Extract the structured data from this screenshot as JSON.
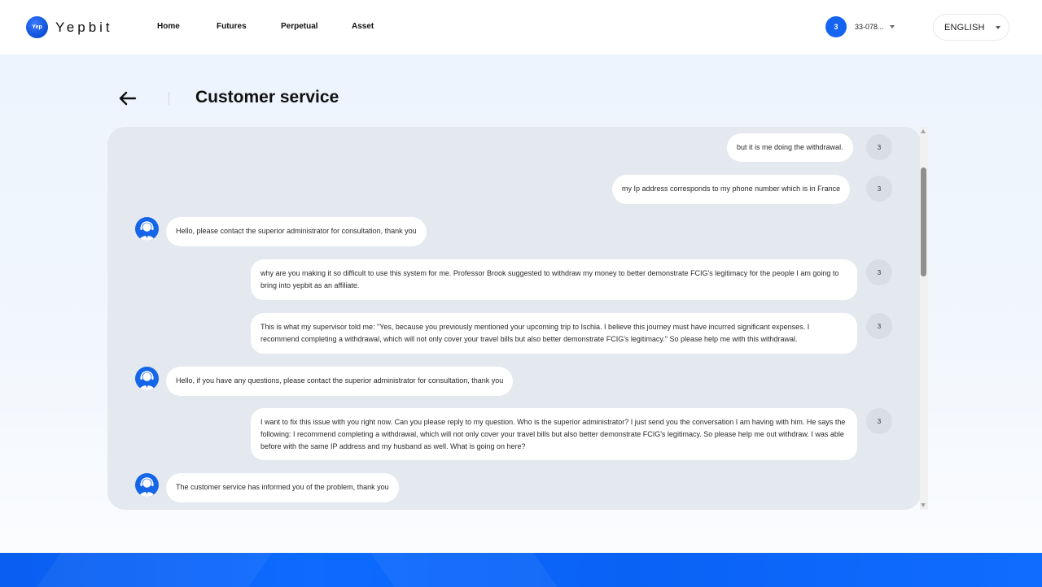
{
  "header": {
    "logo_mark": "Yep",
    "logo_text": "Yepbit",
    "nav": [
      "Home",
      "Futures",
      "Perpetual",
      "Asset"
    ],
    "user_avatar": "3",
    "user_id": "33-078...",
    "language": "ENGLISH"
  },
  "page": {
    "title": "Customer service"
  },
  "chat": {
    "messages": [
      {
        "from": "user",
        "avatar": "3",
        "text": "but it is me doing the withdrawal."
      },
      {
        "from": "user",
        "avatar": "3",
        "text": "my Ip address corresponds to my phone number which is in France"
      },
      {
        "from": "agent",
        "text": "Hello, please contact the superior administrator for consultation, thank you"
      },
      {
        "from": "user",
        "avatar": "3",
        "text": "why are you making it so difficult to use this system for me. Professor Brook suggested to withdraw my money to better demonstrate FCIG's legitimacy for the people I am going to bring into yepbit as an affiliate."
      },
      {
        "from": "user",
        "avatar": "3",
        "text": "This is what my supervisor told me: \"Yes, because you previously mentioned your upcoming trip to Ischia. I believe this journey must have incurred significant expenses. I recommend completing a withdrawal, which will not only cover your travel bills but also better demonstrate FCIG's legitimacy.\" So please help me with this withdrawal."
      },
      {
        "from": "agent",
        "text": "Hello, if you have any questions, please contact the superior administrator for consultation, thank you"
      },
      {
        "from": "user",
        "avatar": "3",
        "text": "I want to fix this issue with you right now. Can you please reply to my question. Who is the superior administrator? I just send you the conversation I am having with him. He says the following: I recommend completing a withdrawal, which will not only cover your travel bills but also better demonstrate FCIG's legitimacy. So please help me out withdraw. I was able before with the same IP address and my husband as well. What is going on here?"
      },
      {
        "from": "agent",
        "text": "The customer service has informed you of the problem, thank you"
      }
    ]
  },
  "colors": {
    "brand_blue": "#1464f0",
    "chat_bg": "#e4e8ef",
    "footer_blue": "#0d6bff"
  },
  "icons": {
    "back": "arrow-left-icon",
    "agent_avatar": "headset-agent-icon",
    "dropdown": "caret-down-icon"
  }
}
